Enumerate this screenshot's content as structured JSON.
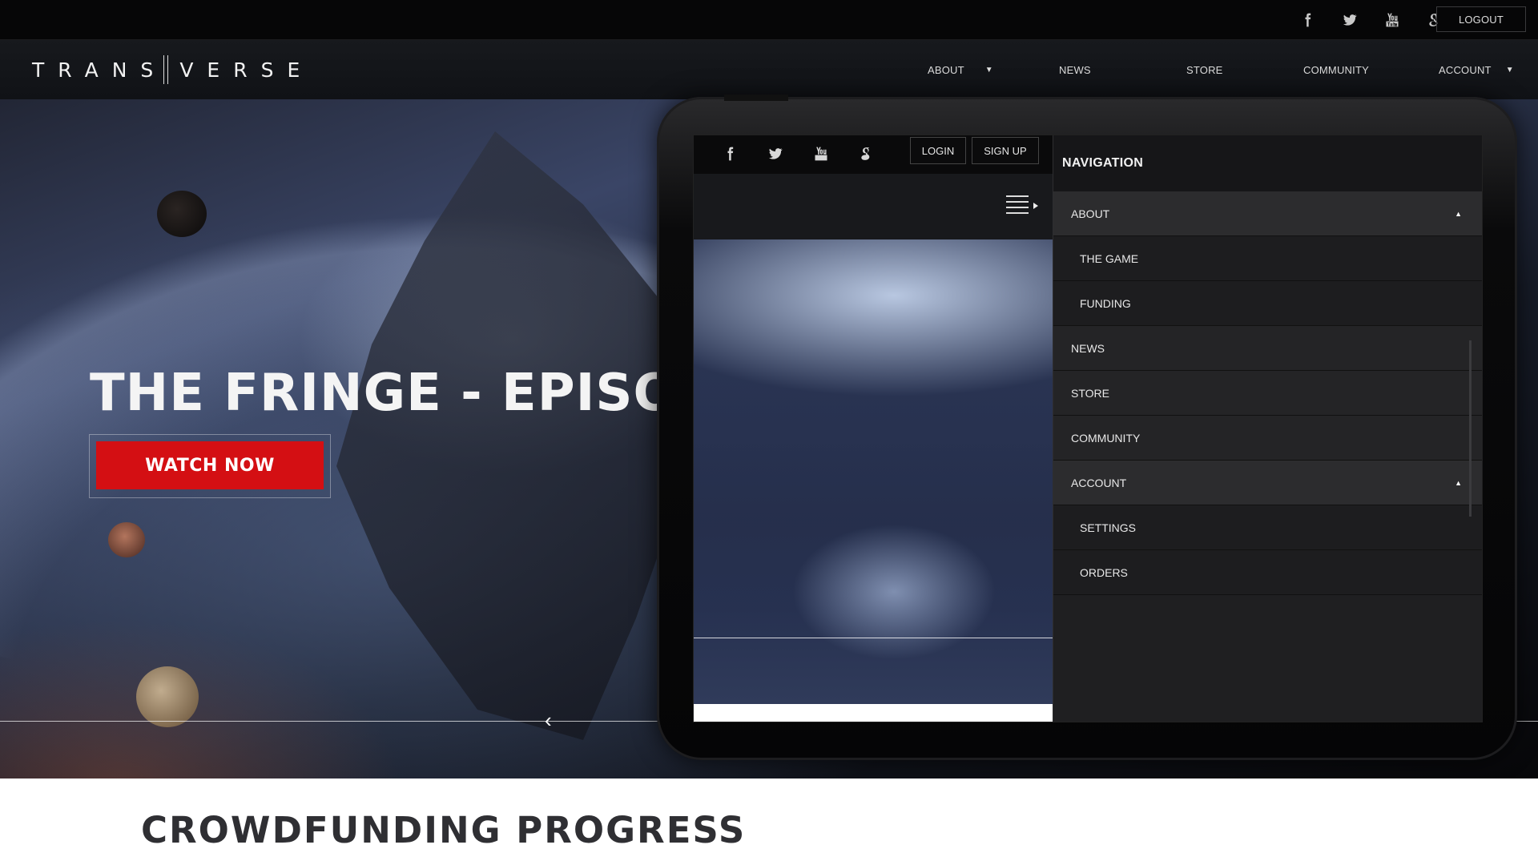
{
  "topbar": {
    "social_icons": [
      "facebook-icon",
      "twitter-icon",
      "youtube-icon",
      "google-icon"
    ],
    "logout_label": "LOGOUT"
  },
  "header": {
    "logo_left": "TRANS",
    "logo_right": "VERSE",
    "nav": {
      "about": "ABOUT",
      "news": "NEWS",
      "store": "STORE",
      "community": "COMMUNITY",
      "account": "ACCOUNT",
      "caret": "▼"
    }
  },
  "hero": {
    "title": "THE FRINGE - EPISODE",
    "cta_label": "WATCH NOW",
    "prev_arrow": "‹"
  },
  "tablet": {
    "login_label": "LOGIN",
    "signup_label": "SIGN UP",
    "nav_heading": "NAVIGATION",
    "nav_items": {
      "about": "ABOUT",
      "the_game": "THE GAME",
      "funding": "FUNDING",
      "news": "NEWS",
      "store": "STORE",
      "community": "COMMUNITY",
      "account": "ACCOUNT",
      "settings": "SETTINGS",
      "orders": "ORDERS"
    },
    "expand_glyph": "▲"
  },
  "section": {
    "crowdfunding_title": "CROWDFUNDING PROGRESS"
  },
  "colors": {
    "accent_red": "#d40f13",
    "bar_dark": "#060607"
  }
}
